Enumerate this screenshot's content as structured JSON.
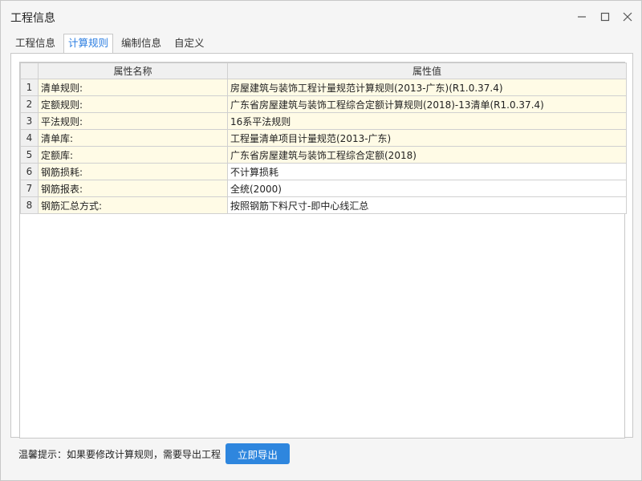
{
  "window": {
    "title": "工程信息",
    "icons": {
      "minimize": "minimize-icon",
      "maximize": "maximize-icon",
      "close": "close-icon"
    }
  },
  "tabs": [
    {
      "label": "工程信息",
      "active": false
    },
    {
      "label": "计算规则",
      "active": true
    },
    {
      "label": "编制信息",
      "active": false
    },
    {
      "label": "自定义",
      "active": false
    }
  ],
  "grid": {
    "headers": {
      "name": "属性名称",
      "value": "属性值"
    },
    "rows": [
      {
        "index": "1",
        "name": "清单规则:",
        "value": "房屋建筑与装饰工程计量规范计算规则(2013-广东)(R1.0.37.4)",
        "highlight": true
      },
      {
        "index": "2",
        "name": "定额规则:",
        "value": "广东省房屋建筑与装饰工程综合定额计算规则(2018)-13清单(R1.0.37.4)",
        "highlight": true
      },
      {
        "index": "3",
        "name": "平法规则:",
        "value": "16系平法规则",
        "highlight": true
      },
      {
        "index": "4",
        "name": "清单库:",
        "value": "工程量清单项目计量规范(2013-广东)",
        "highlight": true
      },
      {
        "index": "5",
        "name": "定额库:",
        "value": "广东省房屋建筑与装饰工程综合定额(2018)",
        "highlight": true
      },
      {
        "index": "6",
        "name": "钢筋损耗:",
        "value": "不计算损耗",
        "highlight": false
      },
      {
        "index": "7",
        "name": "钢筋报表:",
        "value": "全统(2000)",
        "highlight": false
      },
      {
        "index": "8",
        "name": "钢筋汇总方式:",
        "value": "按照钢筋下料尺寸-即中心线汇总",
        "highlight": false
      }
    ]
  },
  "footer": {
    "hint": "温馨提示：如果要修改计算规则，需要导出工程",
    "export_label": "立即导出"
  },
  "colors": {
    "accent": "#2e86de",
    "highlight_row": "#fffbe6",
    "tab_active_text": "#2b7de1"
  }
}
